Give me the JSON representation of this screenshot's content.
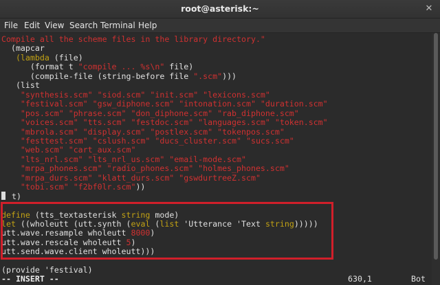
{
  "window": {
    "title": "root@asterisk:~",
    "close_glyph": "✕"
  },
  "menu": [
    "File",
    "Edit",
    "View",
    "Search",
    "Terminal",
    "Help"
  ],
  "editor": {
    "lines": [
      [
        [
          "red",
          "Compile all the scheme files in the library directory.\""
        ]
      ],
      [
        [
          "wht",
          "  (mapcar"
        ]
      ],
      [
        [
          "ylw",
          "   (lambda"
        ],
        [
          "wht",
          " (file)"
        ]
      ],
      [
        [
          "wht",
          "      (format t "
        ],
        [
          "red",
          "\"compile ... %s\\n\""
        ],
        [
          "wht",
          " file)"
        ]
      ],
      [
        [
          "wht",
          "      (compile-file (string-before file "
        ],
        [
          "red",
          "\".scm\""
        ],
        [
          "wht",
          ")))"
        ]
      ],
      [
        [
          "wht",
          "   (list"
        ]
      ],
      [
        [
          "red",
          "    \"synthesis.scm\" \"siod.scm\" \"init.scm\" \"lexicons.scm\""
        ]
      ],
      [
        [
          "red",
          "    \"festival.scm\" \"gsw_diphone.scm\" \"intonation.scm\" \"duration.scm\""
        ]
      ],
      [
        [
          "red",
          "    \"pos.scm\" \"phrase.scm\" \"don_diphone.scm\" \"rab_diphone.scm\""
        ]
      ],
      [
        [
          "red",
          "    \"voices.scm\" \"tts.scm\" \"festdoc.scm\" \"languages.scm\" \"token.scm\""
        ]
      ],
      [
        [
          "red",
          "    \"mbrola.scm\" \"display.scm\" \"postlex.scm\" \"tokenpos.scm\""
        ]
      ],
      [
        [
          "red",
          "    \"festtest.scm\" \"cslush.scm\" \"ducs_cluster.scm\" \"sucs.scm\""
        ]
      ],
      [
        [
          "red",
          "    \"web.scm\" \"cart_aux.scm\""
        ]
      ],
      [
        [
          "red",
          "    \"lts_nrl.scm\" \"lts_nrl_us.scm\" \"email-mode.scm\""
        ]
      ],
      [
        [
          "red",
          "    \"mrpa_phones.scm\" \"radio_phones.scm\" \"holmes_phones.scm\""
        ]
      ],
      [
        [
          "red",
          "    \"mrpa_durs.scm\" \"klatt_durs.scm\" \"gswdurtreeZ.scm\""
        ]
      ],
      [
        [
          "red",
          "    \"tobi.scm\" \"f2bf0lr.scm\""
        ],
        [
          "wht",
          "))"
        ]
      ],
      [
        [
          "cursor",
          ""
        ],
        [
          "wht",
          " t)"
        ]
      ],
      [
        [
          "wht",
          ""
        ]
      ],
      [
        [
          "ylw",
          "define"
        ],
        [
          "wht",
          " (tts_textasterisk "
        ],
        [
          "ylw",
          "string"
        ],
        [
          "wht",
          " mode)"
        ]
      ],
      [
        [
          "ylw",
          "let"
        ],
        [
          "wht",
          " ((wholeutt (utt.synth ("
        ],
        [
          "ylw",
          "eval"
        ],
        [
          "wht",
          " ("
        ],
        [
          "ylw",
          "list"
        ],
        [
          "wht",
          " 'Utterance 'Text "
        ],
        [
          "ylw",
          "string"
        ],
        [
          "wht",
          ")))))"
        ]
      ],
      [
        [
          "wht",
          "utt.wave.resample wholeutt "
        ],
        [
          "red",
          "8000"
        ],
        [
          "wht",
          ")"
        ]
      ],
      [
        [
          "wht",
          "utt.wave.rescale wholeutt "
        ],
        [
          "red",
          "5"
        ],
        [
          "wht",
          ")"
        ]
      ],
      [
        [
          "wht",
          "utt.send.wave.client wholeutt)))"
        ]
      ],
      [
        [
          "wht",
          ""
        ]
      ],
      [
        [
          "wht",
          "(provide 'festival)"
        ]
      ]
    ]
  },
  "status": {
    "mode": "-- INSERT --",
    "position": "630,1",
    "scroll": "Bot"
  }
}
